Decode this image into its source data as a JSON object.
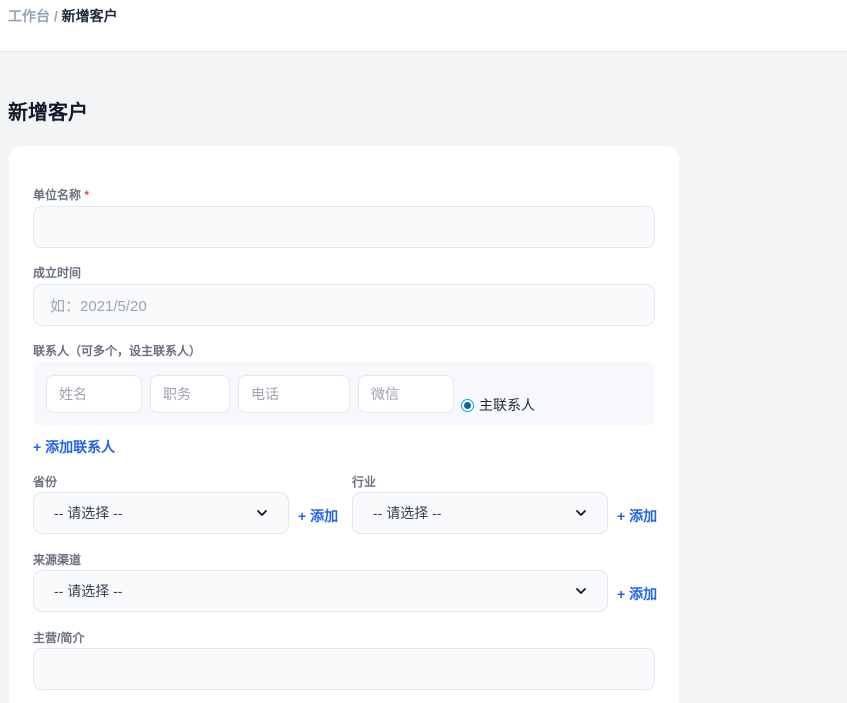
{
  "breadcrumb": {
    "home": "工作台",
    "separator": "/",
    "current": "新增客户"
  },
  "page": {
    "title": "新增客户"
  },
  "form": {
    "company_name": {
      "label": "单位名称",
      "required_mark": "*",
      "value": ""
    },
    "founded": {
      "label": "成立时间",
      "placeholder": "如：2021/5/20"
    },
    "contacts": {
      "label": "联系人（可多个，设主联系人）",
      "name_placeholder": "姓名",
      "title_placeholder": "职务",
      "phone_placeholder": "电话",
      "wechat_placeholder": "微信",
      "primary_label": "主联系人",
      "primary_checked": true,
      "add_label": "+ 添加联系人"
    },
    "province": {
      "label": "省份",
      "selected": "-- 请选择 --",
      "add_label": "+ 添加"
    },
    "industry": {
      "label": "行业",
      "selected": "-- 请选择 --",
      "add_label": "+ 添加"
    },
    "source": {
      "label": "来源渠道",
      "selected": "-- 请选择 --",
      "add_label": "+ 添加"
    },
    "business": {
      "label": "主营/简介",
      "value": ""
    }
  },
  "icons": {
    "chevron": "chevron-down-icon",
    "radio": "radio-icon"
  },
  "colors": {
    "accent": "#2563eb",
    "required": "#ef4444",
    "radio": "#0369a1"
  }
}
